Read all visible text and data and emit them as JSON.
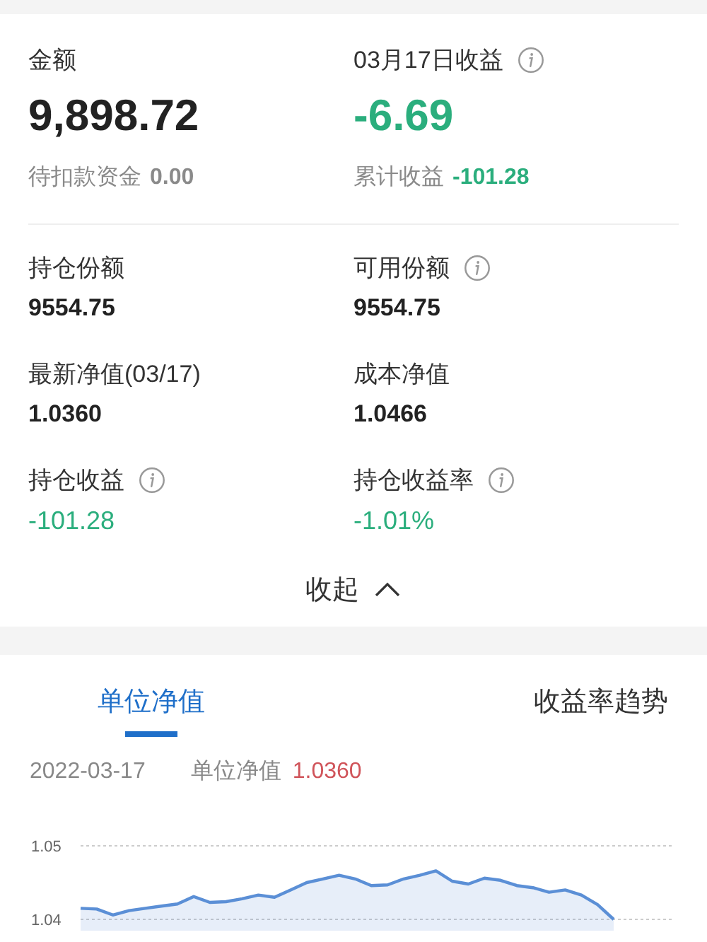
{
  "summary": [
    {
      "label": "金额",
      "info": false,
      "value": "9,898.72",
      "color": "#222222",
      "sub": {
        "label": "待扣款资金",
        "value": "0.00",
        "color": "#8a8a8a"
      }
    },
    {
      "label": "03月17日收益",
      "info": true,
      "value": "-6.69",
      "color": "#2bae7d",
      "sub": {
        "label": "累计收益",
        "value": "-101.28",
        "color": "#2bae7d"
      }
    }
  ],
  "details": [
    {
      "label": "持仓份额",
      "info": false,
      "value": "9554.75",
      "color": "#222222"
    },
    {
      "label": "可用份额",
      "info": true,
      "value": "9554.75",
      "color": "#222222"
    },
    {
      "label": "最新净值(03/17)",
      "info": false,
      "value": "1.0360",
      "color": "#222222"
    },
    {
      "label": "成本净值",
      "info": false,
      "value": "1.0466",
      "color": "#222222"
    },
    {
      "label": "持仓收益",
      "info": true,
      "value": "-101.28",
      "color": "#2bae7d"
    },
    {
      "label": "持仓收益率",
      "info": true,
      "value": "-1.01%",
      "color": "#2bae7d"
    }
  ],
  "collapse": {
    "label": "收起",
    "expanded": true
  },
  "tabs": [
    {
      "label": "单位净值",
      "selected": true
    },
    {
      "label": "收益率趋势",
      "selected": false
    }
  ],
  "quote": {
    "date": "2022-03-17",
    "label": "单位净值",
    "value": "1.0360"
  },
  "chart": {
    "chart_data": {
      "type": "area",
      "yticks": [
        1.04,
        1.05
      ],
      "ylim": [
        1.04,
        1.05
      ],
      "series": [
        {
          "color": "#5b8fd6",
          "values": [
            1.0415,
            1.0414,
            1.0406,
            1.0412,
            1.0415,
            1.0418,
            1.0421,
            1.0431,
            1.0423,
            1.0424,
            1.0428,
            1.0433,
            1.043,
            1.044,
            1.045,
            1.0455,
            1.046,
            1.0455,
            1.0446,
            1.0447,
            1.0455,
            1.046,
            1.0466,
            1.0452,
            1.0448,
            1.0456,
            1.0453,
            1.0446,
            1.0443,
            1.0437,
            1.044,
            1.0433,
            1.042,
            1.04
          ]
        }
      ]
    }
  }
}
